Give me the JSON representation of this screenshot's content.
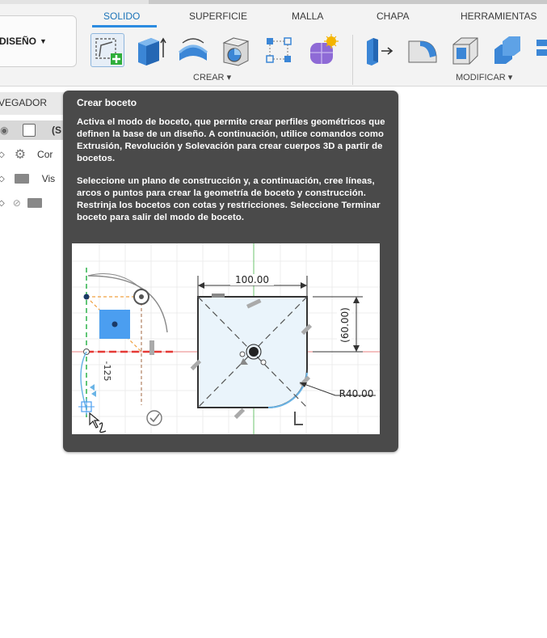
{
  "toolbar": {
    "workspace_label": "DISEÑO",
    "tabs": [
      {
        "label": "SOLIDO",
        "active": true
      },
      {
        "label": "SUPERFICIE",
        "active": false
      },
      {
        "label": "MALLA",
        "active": false
      },
      {
        "label": "CHAPA",
        "active": false
      },
      {
        "label": "HERRAMIENTAS",
        "active": false
      }
    ],
    "groups": [
      {
        "label": "CREAR"
      },
      {
        "label": "MODIFICAR"
      }
    ],
    "create_tools": [
      "create-sketch-icon",
      "extrude-icon",
      "revolve-icon",
      "hole-icon",
      "pattern-icon",
      "form-icon"
    ],
    "modify_tools": [
      "press-pull-icon",
      "fillet-icon",
      "shell-icon",
      "combine-icon",
      "more-icon"
    ]
  },
  "browser": {
    "header": "VEGADOR",
    "rows": [
      {
        "label": "(S",
        "icon": "component-icon"
      },
      {
        "label": "Cor",
        "icon": "gear-icon"
      },
      {
        "label": "Vis",
        "icon": "folder-icon"
      },
      {
        "label": "",
        "icon": "folder-icon"
      }
    ]
  },
  "tooltip": {
    "title": "Crear boceto",
    "paragraph1": "Activa el modo de boceto, que permite crear perfiles geométricos que definen la base de un diseño. A continuación, utilice comandos como Extrusión, Revolución y Solevación para crear cuerpos 3D a partir de bocetos.",
    "paragraph2": "Seleccione un plano de construcción y, a continuación, cree líneas, arcos o puntos para crear la geometría de boceto y construcción. Restrinja los bocetos con cotas y restricciones. Seleccione Terminar boceto para salir del modo de boceto.",
    "illustration": {
      "dim_width": "100.00",
      "dim_height": "(60.00)",
      "dim_radius": "R40.00",
      "dim_left": "-125"
    }
  },
  "colors": {
    "accent": "#1a73b8",
    "tooltip_bg": "#4a4a4a",
    "sketch_fill": "#eaf4fb",
    "axis_red": "#e53935",
    "axis_green": "#2db34a"
  }
}
